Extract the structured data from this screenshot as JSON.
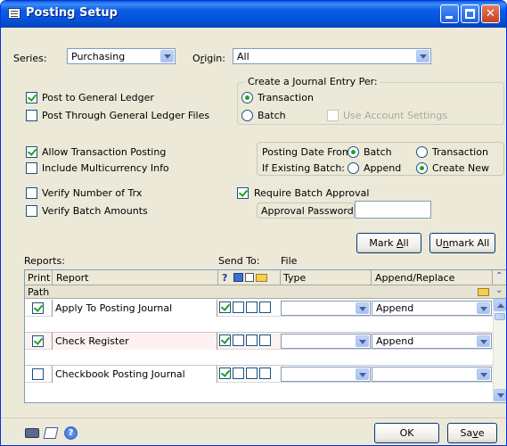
{
  "window": {
    "title": "Posting Setup"
  },
  "series": {
    "label": "Series:",
    "value": "Purchasing"
  },
  "origin": {
    "label_prefix": "O",
    "label_underline": "r",
    "label_suffix": "igin:",
    "value": "All"
  },
  "journal_group": {
    "title": "Create a Journal Entry Per:",
    "options": [
      "Transaction",
      "Batch"
    ],
    "selected": "Transaction",
    "use_account_settings": "Use Account Settings"
  },
  "checks": {
    "post_to_gl": {
      "label": "Post to General Ledger",
      "checked": true
    },
    "post_through_gl": {
      "label": "Post Through General Ledger Files",
      "checked": false
    },
    "allow_transaction_posting": {
      "label": "Allow Transaction Posting",
      "checked": true
    },
    "include_multicurrency": {
      "label": "Include Multicurrency Info",
      "checked": false
    },
    "verify_number_trx": {
      "label": "Verify Number of Trx",
      "checked": false
    },
    "verify_batch_amounts": {
      "label": "Verify Batch Amounts",
      "checked": false
    },
    "require_batch_approval": {
      "label": "Require Batch Approval",
      "checked": true
    }
  },
  "posting_date": {
    "label": "Posting Date From:",
    "options": [
      "Batch",
      "Transaction"
    ],
    "selected": "Batch"
  },
  "existing_batch": {
    "label": "If Existing Batch:",
    "options": [
      "Append",
      "Create New"
    ],
    "selected": "Create New"
  },
  "approval_password": {
    "label": "Approval Password",
    "value": ""
  },
  "buttons": {
    "mark_all": {
      "prefix": "Mark ",
      "underline": "A",
      "suffix": "ll"
    },
    "unmark_all": {
      "prefix": "U",
      "underline": "n",
      "suffix": "mark All"
    },
    "ok": "OK",
    "save": {
      "prefix": "Sa",
      "underline": "v",
      "suffix": "e"
    }
  },
  "grid_labels": {
    "reports": "Reports:",
    "send_to": "Send To:",
    "file": "File"
  },
  "grid_headers": {
    "print": "Print",
    "report": "Report",
    "help": "?",
    "type": "Type",
    "append_replace": "Append/Replace",
    "path": "Path"
  },
  "grid_rows": [
    {
      "print": true,
      "report": "Apply To Posting Journal",
      "send": [
        true,
        false,
        false,
        false
      ],
      "type": "",
      "append": "Append"
    },
    {
      "print": true,
      "report": "Check Register",
      "send": [
        true,
        false,
        false,
        false
      ],
      "type": "",
      "append": "Append"
    },
    {
      "print": false,
      "report": "Checkbook Posting Journal",
      "send": [
        true,
        false,
        false,
        false
      ],
      "type": "",
      "append": ""
    }
  ],
  "colors": {
    "title_bar": "#0a5ce6",
    "face": "#ece9d8",
    "check_green": "#21a121"
  }
}
